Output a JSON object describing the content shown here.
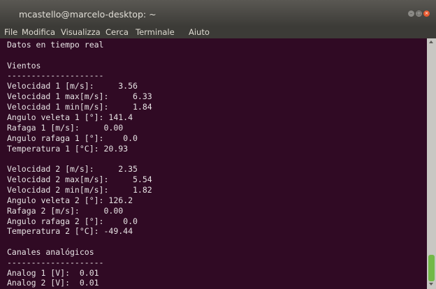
{
  "window": {
    "title": "mcastello@marcelo-desktop: ~",
    "buttons": {
      "minimize": "–",
      "maximize": "□",
      "close": "×"
    }
  },
  "menubar": {
    "items": [
      "File",
      "Modifica",
      "Visualizza",
      "Cerca",
      "Terminale",
      "Aiuto"
    ]
  },
  "terminal": {
    "lines": [
      "Datos en tiempo real",
      "",
      "Vientos",
      "--------------------",
      "Velocidad 1 [m/s]:     3.56",
      "Velocidad 1 max[m/s]:     6.33",
      "Velocidad 1 min[m/s]:     1.84",
      "Angulo veleta 1 [°]: 141.4",
      "Rafaga 1 [m/s]:     0.00",
      "Angulo rafaga 1 [°]:    0.0",
      "Temperatura 1 [°C]: 20.93",
      "",
      "Velocidad 2 [m/s]:     2.35",
      "Velocidad 2 max[m/s]:     5.54",
      "Velocidad 2 min[m/s]:     1.82",
      "Angulo veleta 2 [°]: 126.2",
      "Rafaga 2 [m/s]:     0.00",
      "Angulo rafaga 2 [°]:    0.0",
      "Temperatura 2 [°C]: -49.44",
      "",
      "Canales analógicos",
      "--------------------",
      "Analog 1 [V]:  0.01",
      "Analog 2 [V]:  0.01"
    ]
  },
  "colors": {
    "terminal_background": "#300a24",
    "terminal_text": "#e7e3e4",
    "titlebar": "#3c3b37",
    "close_button": "#e8592f",
    "scroll_thumb": "#73b948"
  }
}
